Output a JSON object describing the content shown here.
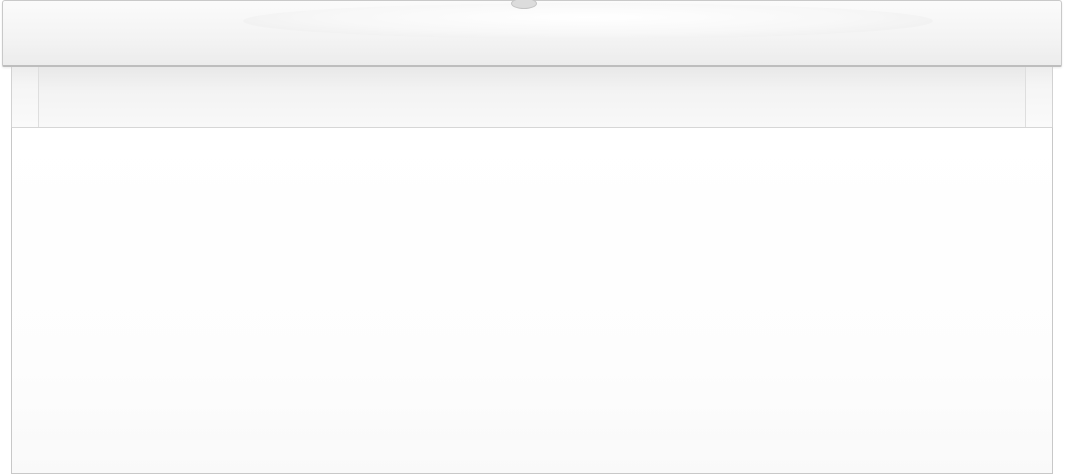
{
  "scene": {
    "subject": "vanity",
    "colors": {
      "background": "#ffffff",
      "surface": "#f4f4f4",
      "outline": "#c8c8c8"
    }
  }
}
